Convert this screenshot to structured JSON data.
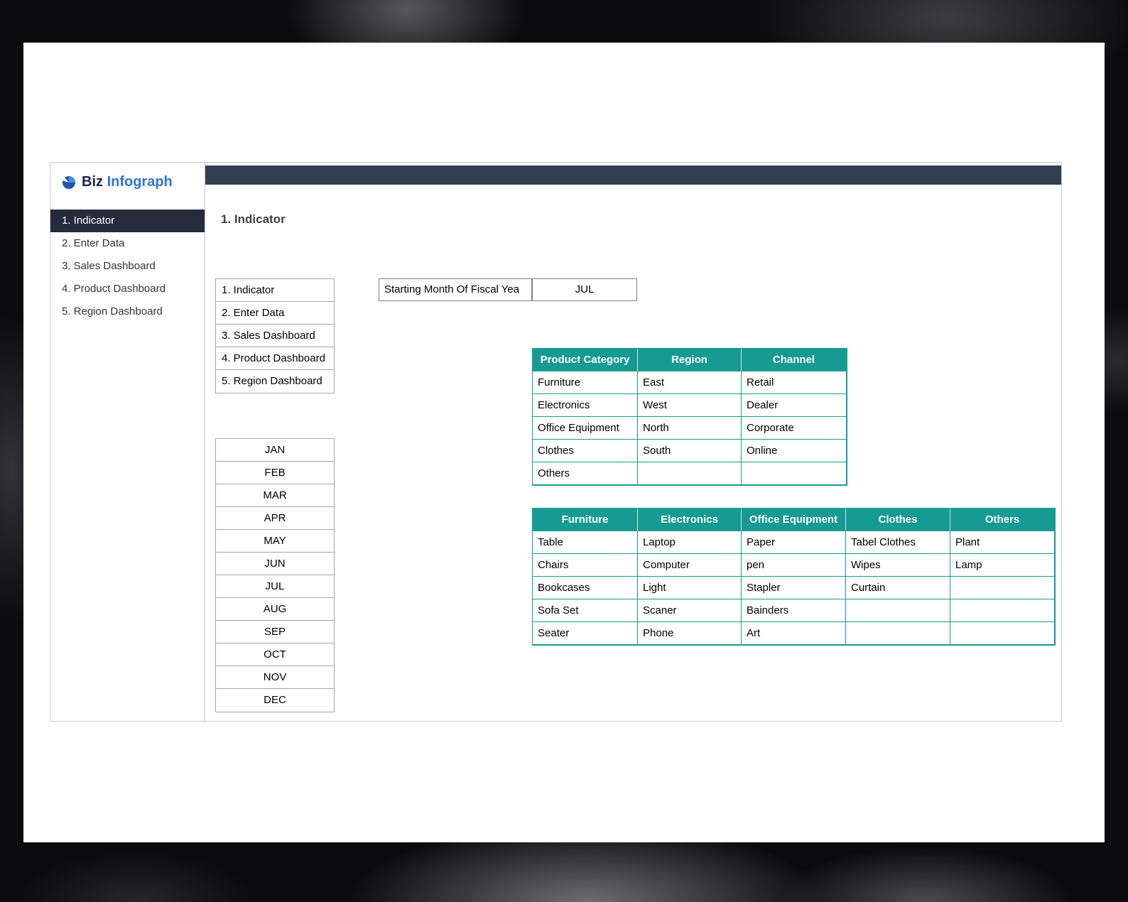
{
  "logo": {
    "brand_prefix": "Biz",
    "brand_suffix": "Infograph",
    "icon": "pie-chart-icon"
  },
  "sidebar": {
    "items": [
      {
        "label": "1. Indicator",
        "active": true
      },
      {
        "label": "2. Enter Data",
        "active": false
      },
      {
        "label": "3. Sales Dashboard",
        "active": false
      },
      {
        "label": "4. Product Dashboard",
        "active": false
      },
      {
        "label": "5. Region Dashboard",
        "active": false
      }
    ]
  },
  "main": {
    "title": "1. Indicator",
    "nav_list": [
      "1. Indicator",
      "2. Enter Data",
      "3. Sales Dashboard",
      "4. Product Dashboard",
      "5. Region Dashboard"
    ],
    "fiscal": {
      "label": "Starting Month Of Fiscal Yea",
      "value": "JUL"
    },
    "months": [
      "JAN",
      "FEB",
      "MAR",
      "APR",
      "MAY",
      "JUN",
      "JUL",
      "AUG",
      "SEP",
      "OCT",
      "NOV",
      "DEC"
    ],
    "category_table": {
      "headers": [
        "Product Category",
        "Region",
        "Channel"
      ],
      "rows": [
        [
          "Furniture",
          "East",
          "Retail"
        ],
        [
          "Electronics",
          "West",
          "Dealer"
        ],
        [
          "Office Equipment",
          "North",
          "Corporate"
        ],
        [
          "Clothes",
          "South",
          "Online"
        ],
        [
          "Others",
          "",
          ""
        ]
      ]
    },
    "product_table": {
      "headers": [
        "Furniture",
        "Electronics",
        "Office Equipment",
        "Clothes",
        "Others"
      ],
      "rows": [
        [
          "Table",
          "Laptop",
          "Paper",
          "Tabel Clothes",
          "Plant"
        ],
        [
          "Chairs",
          "Computer",
          "pen",
          "Wipes",
          "Lamp"
        ],
        [
          "Bookcases",
          "Light",
          "Stapler",
          "Curtain",
          ""
        ],
        [
          "Sofa Set",
          "Scaner",
          "Bainders",
          "",
          ""
        ],
        [
          "Seater",
          "Phone",
          "Art",
          "",
          ""
        ]
      ]
    }
  },
  "colors": {
    "teal_accent": "#169b93",
    "topbar": "#333f50",
    "active_nav": "#262b3c",
    "brand_blue": "#2e75d8",
    "brand_dark": "#16244c"
  }
}
